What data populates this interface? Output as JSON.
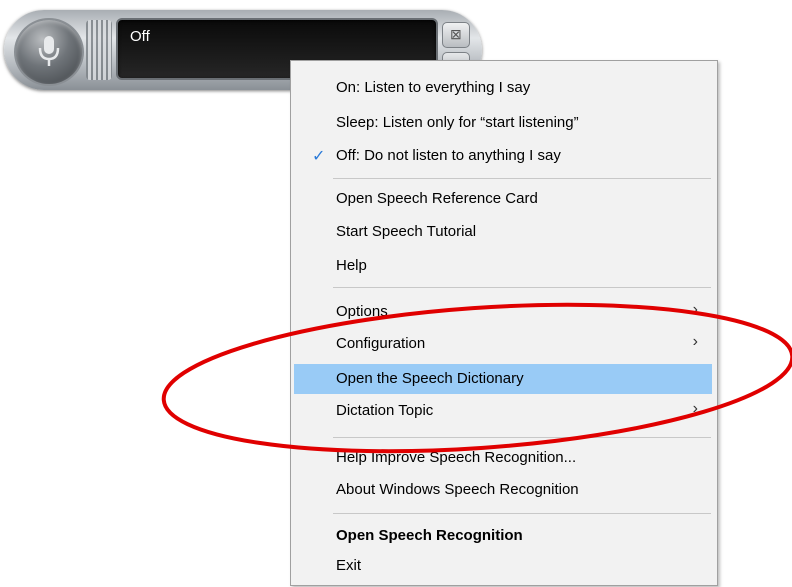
{
  "speech_bar": {
    "status": "Off",
    "close_glyph": "⊠",
    "mic_icon": "microphone-icon"
  },
  "menu": {
    "items": [
      {
        "label": "On: Listen to everything I say"
      },
      {
        "label": "Sleep: Listen only for “start listening”"
      },
      {
        "label": "Off: Do not listen to anything I say",
        "checked": true
      },
      {
        "label": "Open Speech Reference Card"
      },
      {
        "label": "Start Speech Tutorial"
      },
      {
        "label": "Help"
      },
      {
        "label": "Options",
        "submenu": true
      },
      {
        "label": "Configuration",
        "submenu": true
      },
      {
        "label": "Open the Speech Dictionary",
        "highlighted": true
      },
      {
        "label": "Dictation Topic",
        "submenu": true
      },
      {
        "label": "Help Improve Speech Recognition..."
      },
      {
        "label": "About Windows Speech Recognition"
      },
      {
        "label": "Open Speech Recognition",
        "bold": true
      },
      {
        "label": "Exit"
      }
    ],
    "check_glyph": "✓",
    "submenu_glyph": "›"
  },
  "colors": {
    "highlight": "#99cbf6",
    "annotation": "#e00000",
    "check": "#2a7ad8"
  }
}
